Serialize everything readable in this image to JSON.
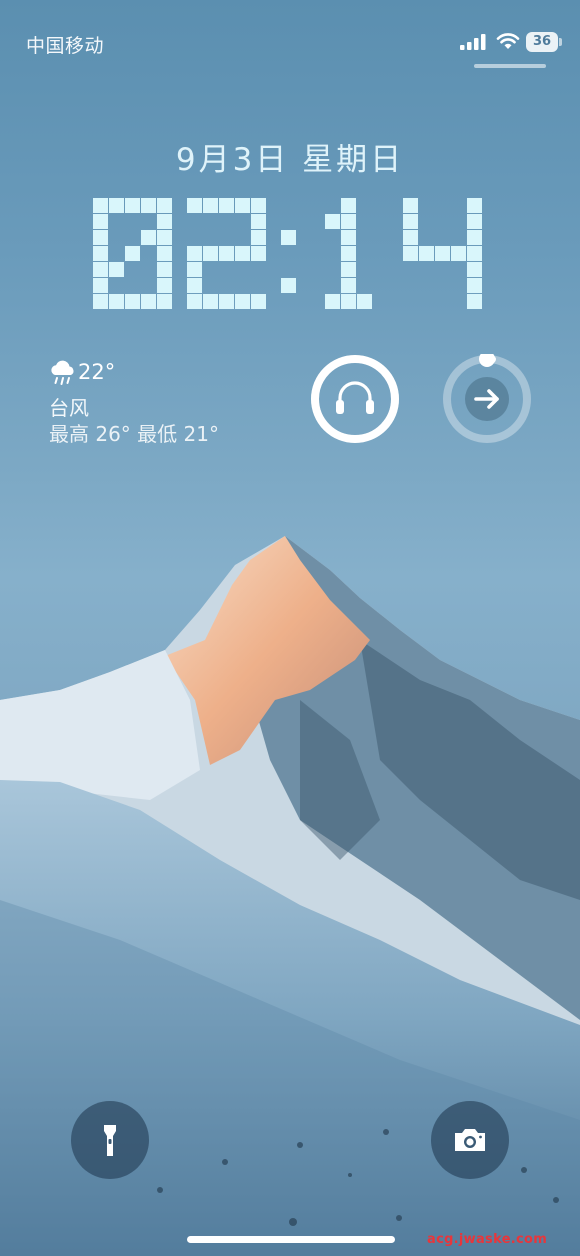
{
  "status_bar": {
    "carrier": "中国移动",
    "battery_level": "36",
    "signal_bars": 4,
    "signal_icon": "cellular-signal-icon",
    "wifi_icon": "wifi-icon"
  },
  "lock_screen": {
    "date": "9月3日 星期日",
    "time": "02:14"
  },
  "weather_widget": {
    "icon": "cloud-rain-icon",
    "temperature": "22°",
    "condition": "台风",
    "range": "最高 26° 最低 21°"
  },
  "widgets": {
    "headphones": {
      "icon": "headphones-icon",
      "ring_fill": 1.0
    },
    "shortcut": {
      "icon": "arrow-right-icon",
      "ring_fill": 0.02
    }
  },
  "quick_actions": {
    "flashlight_icon": "flashlight-icon",
    "camera_icon": "camera-icon"
  },
  "wallpaper": {
    "subject": "snow-capped mountain",
    "sky_color": "#7da9c5",
    "snow_color": "#dbe7ef",
    "sunlit_color": "#f0b084"
  },
  "watermark": "acg.jwaske.com",
  "colors": {
    "clock": "#d9f6fb",
    "ring_track": "rgba(255,255,255,0.35)"
  }
}
